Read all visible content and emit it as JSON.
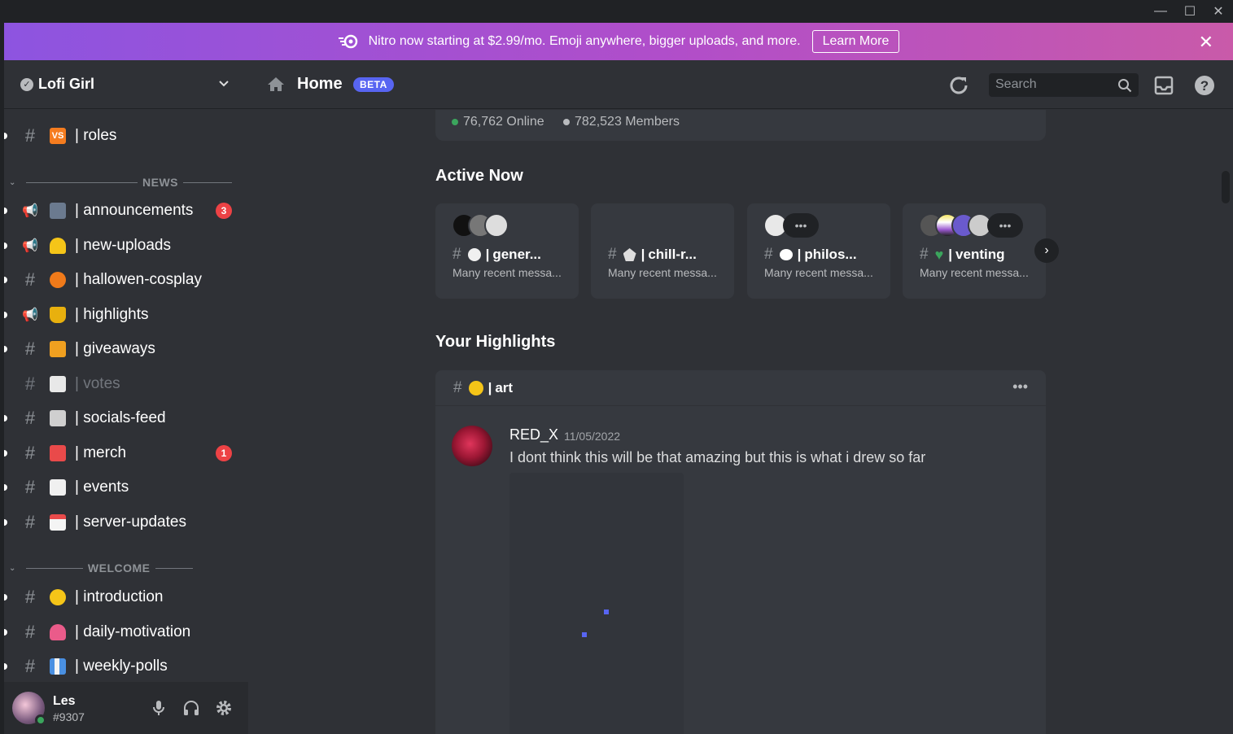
{
  "banner": {
    "text": "Nitro now starting at $2.99/mo. Emoji anywhere, bigger uploads, and more.",
    "cta": "Learn More"
  },
  "sidebar": {
    "server_name": "Lofi Girl",
    "top_channel": {
      "name": "roles",
      "emoji": "VS"
    },
    "categories": {
      "news": "NEWS",
      "welcome": "WELCOME"
    },
    "news_channels": [
      {
        "name": "announcements",
        "badge": "3"
      },
      {
        "name": "new-uploads"
      },
      {
        "name": "hallowen-cosplay"
      },
      {
        "name": "highlights"
      },
      {
        "name": "giveaways"
      },
      {
        "name": "votes"
      },
      {
        "name": "socials-feed"
      },
      {
        "name": "merch",
        "badge": "1"
      },
      {
        "name": "events"
      },
      {
        "name": "server-updates"
      }
    ],
    "welcome_channels": [
      {
        "name": "introduction"
      },
      {
        "name": "daily-motivation"
      },
      {
        "name": "weekly-polls"
      }
    ],
    "user": {
      "name": "Les",
      "tag": "#9307"
    }
  },
  "topbar": {
    "title": "Home",
    "badge": "BETA",
    "search_placeholder": "Search"
  },
  "stats": {
    "online": "76,762 Online",
    "members": "782,523 Members"
  },
  "active_now": {
    "title": "Active Now",
    "cards": [
      {
        "channel": "gener...",
        "sub": "Many recent messa..."
      },
      {
        "channel": "chill-r...",
        "sub": "Many recent messa..."
      },
      {
        "channel": "philos...",
        "sub": "Many recent messa..."
      },
      {
        "channel": "venting",
        "sub": "Many recent messa..."
      }
    ]
  },
  "highlights": {
    "title": "Your Highlights",
    "channel": "art",
    "message": {
      "author": "RED_X",
      "time": "11/05/2022",
      "text": "I dont think this will be that amazing but this is what i drew so far"
    }
  },
  "colors": {
    "accent": "#5865f2",
    "online": "#3ba55d",
    "badge": "#ed4245"
  }
}
